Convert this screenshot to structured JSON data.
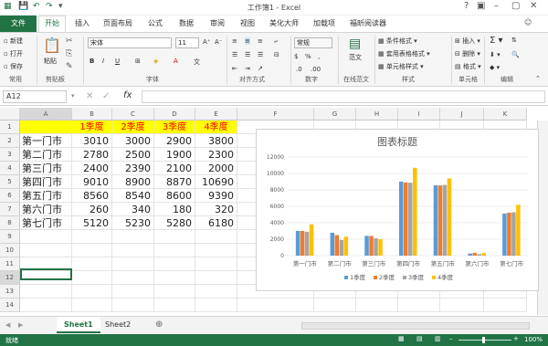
{
  "window": {
    "title": "工作簿1 - Excel"
  },
  "tabs": [
    "开始",
    "插入",
    "页面布局",
    "公式",
    "数据",
    "审阅",
    "视图",
    "美化大师",
    "加载项",
    "福昕阅读器"
  ],
  "file_tab": "文件",
  "ribbon": {
    "clipboard": {
      "new": "新建",
      "open": "打开",
      "save": "保存",
      "paste": "粘贴",
      "group": "常用",
      "group2": "剪贴板"
    },
    "font": {
      "name": "宋体",
      "size": "11",
      "group": "字体"
    },
    "align": {
      "group": "对齐方式"
    },
    "number": {
      "format": "常规",
      "group": "数字"
    },
    "view": {
      "label": "范文",
      "group": "在线范文"
    },
    "styles": {
      "cond": "条件格式",
      "table": "套用表格格式",
      "cell": "单元格样式",
      "group": "样式"
    },
    "cells": {
      "insert": "插入",
      "delete": "删除",
      "format": "格式",
      "group": "单元格"
    },
    "edit": {
      "group": "编辑"
    }
  },
  "formula_bar": {
    "namebox": "A12",
    "fx": "fx"
  },
  "columns": [
    "A",
    "B",
    "C",
    "D",
    "E",
    "F",
    "G",
    "H",
    "I",
    "J",
    "K"
  ],
  "rows": [
    "1",
    "2",
    "3",
    "4",
    "5",
    "6",
    "7",
    "8",
    "9",
    "10",
    "11",
    "12",
    "13",
    "14"
  ],
  "table": {
    "headers": [
      "",
      "1季度",
      "2季度",
      "3季度",
      "4季度"
    ],
    "data": [
      [
        "第一门市",
        "3010",
        "3000",
        "2900",
        "3800"
      ],
      [
        "第二门市",
        "2780",
        "2500",
        "1900",
        "2300"
      ],
      [
        "第三门市",
        "2400",
        "2390",
        "2100",
        "2000"
      ],
      [
        "第四门市",
        "9010",
        "8900",
        "8870",
        "10690"
      ],
      [
        "第五门市",
        "8560",
        "8540",
        "8600",
        "9390"
      ],
      [
        "第六门市",
        "260",
        "340",
        "180",
        "320"
      ],
      [
        "第七门市",
        "5120",
        "5230",
        "5280",
        "6180"
      ]
    ]
  },
  "chart_data": {
    "type": "bar",
    "title": "图表标题",
    "categories": [
      "第一门市",
      "第二门市",
      "第三门市",
      "第四门市",
      "第五门市",
      "第六门市",
      "第七门市"
    ],
    "series": [
      {
        "name": "1季度",
        "color": "#5b9bd5",
        "values": [
          3010,
          2780,
          2400,
          9010,
          8560,
          260,
          5120
        ]
      },
      {
        "name": "2季度",
        "color": "#ed7d31",
        "values": [
          3000,
          2500,
          2390,
          8900,
          8540,
          340,
          5230
        ]
      },
      {
        "name": "3季度",
        "color": "#a5a5a5",
        "values": [
          2900,
          1900,
          2100,
          8870,
          8600,
          180,
          5280
        ]
      },
      {
        "name": "4季度",
        "color": "#ffc000",
        "values": [
          3800,
          2300,
          2000,
          10690,
          9390,
          320,
          6180
        ]
      }
    ],
    "yticks": [
      "0",
      "2000",
      "4000",
      "6000",
      "8000",
      "10000",
      "12000"
    ],
    "ylim": [
      0,
      12000
    ],
    "grid": true,
    "legend": "bottom"
  },
  "sheets": [
    "Sheet1",
    "Sheet2"
  ],
  "status": {
    "left": "就绪",
    "zoom": "100%"
  }
}
